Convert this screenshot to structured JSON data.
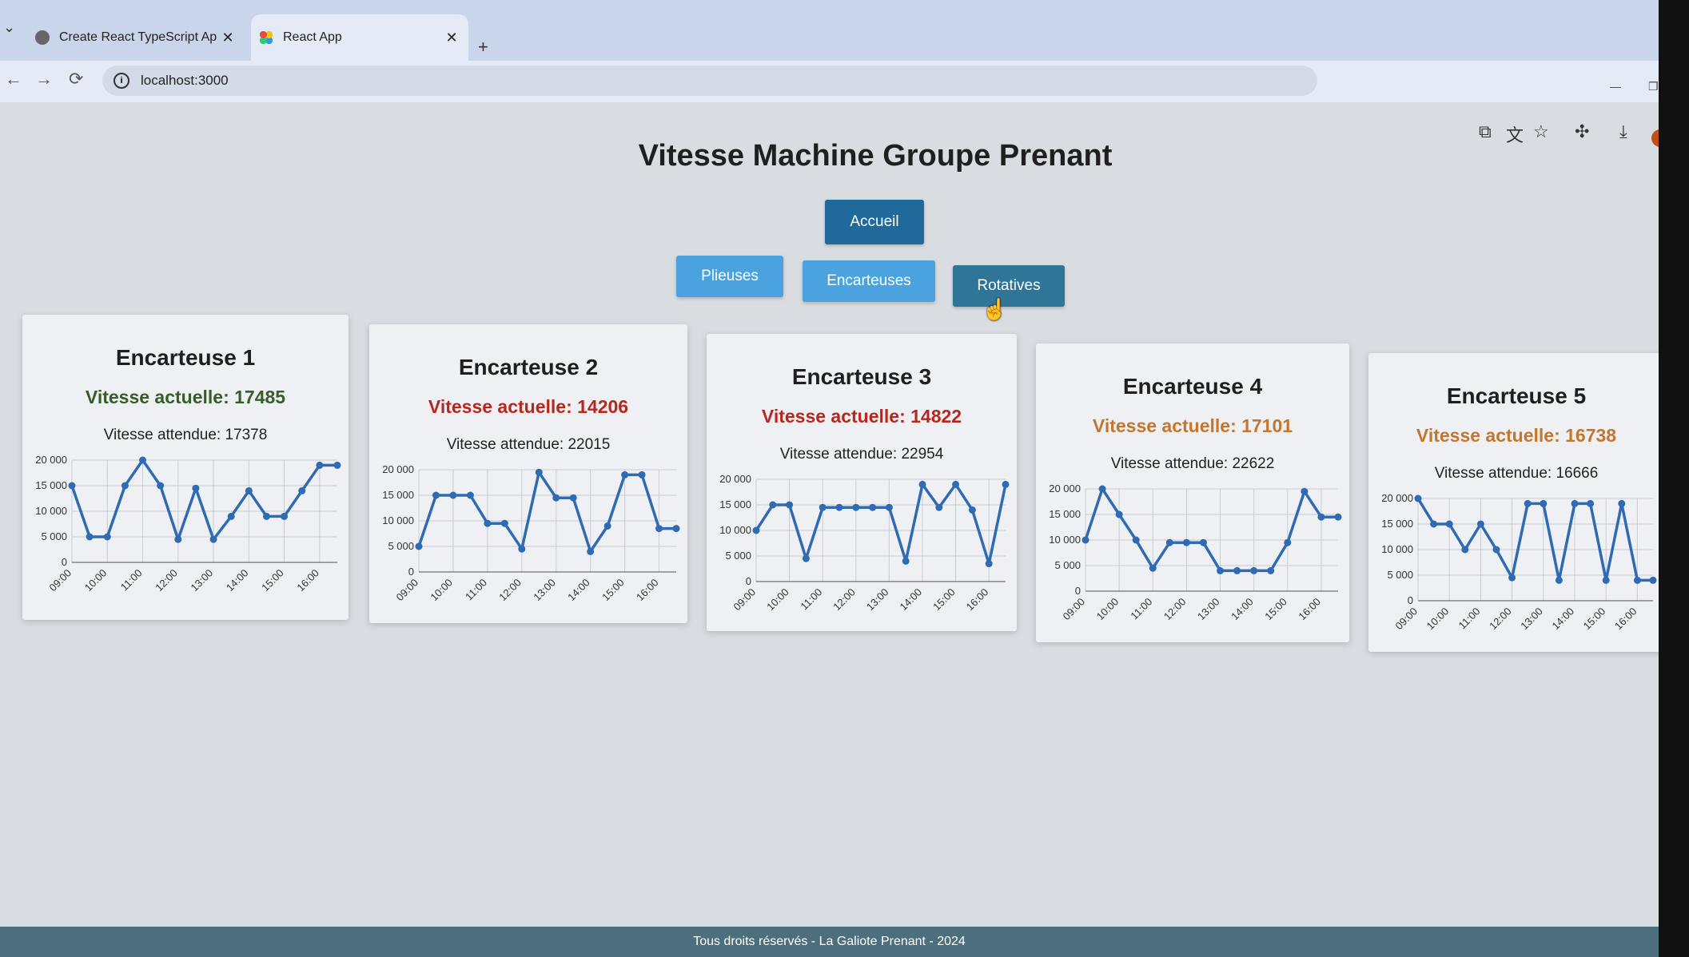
{
  "browser": {
    "tabs": [
      {
        "title": "Create React TypeScript App",
        "close": "✕"
      },
      {
        "title": "React App",
        "close": "✕"
      }
    ],
    "new_tab": "+",
    "url": "localhost:3000",
    "icons": [
      "back-icon",
      "forward-icon",
      "reload-icon",
      "info-icon",
      "cast-icon",
      "translate-icon",
      "star-icon",
      "extensions-icon",
      "download-icon",
      "profile-avatar"
    ],
    "profile_initial": "!"
  },
  "page": {
    "title": "Vitesse Machine Groupe Prenant",
    "home_button": "Accueil",
    "nav": [
      "Plieuses",
      "Encarteuses",
      "Rotatives"
    ],
    "footer": "Tous droits réservés - La Galiote Prenant - 2024",
    "colors": {
      "good": "#355e2a",
      "bad": "#b8271d",
      "warn": "#c3762e",
      "line": "#2f6bb3"
    }
  },
  "cards": [
    {
      "title": "Encarteuse 1",
      "current": "Vitesse actuelle: 17485",
      "expected": "Vitesse attendue: 17378",
      "status": "good"
    },
    {
      "title": "Encarteuse 2",
      "current": "Vitesse actuelle: 14206",
      "expected": "Vitesse attendue: 22015",
      "status": "bad"
    },
    {
      "title": "Encarteuse 3",
      "current": "Vitesse actuelle: 14822",
      "expected": "Vitesse attendue: 22954",
      "status": "bad"
    },
    {
      "title": "Encarteuse 4",
      "current": "Vitesse actuelle: 17101",
      "expected": "Vitesse attendue: 22622",
      "status": "warn"
    },
    {
      "title": "Encarteuse 5",
      "current": "Vitesse actuelle: 16738",
      "expected": "Vitesse attendue: 16666",
      "status": "warn"
    }
  ],
  "chart_data": [
    {
      "type": "line",
      "x": [
        "09:00",
        "09:30",
        "10:00",
        "10:30",
        "11:00",
        "11:30",
        "12:00",
        "12:30",
        "13:00",
        "13:30",
        "14:00",
        "14:30",
        "15:00",
        "15:30",
        "16:00",
        "16:30"
      ],
      "x_ticks": [
        "09:00",
        "10:00",
        "11:00",
        "12:00",
        "13:00",
        "14:00",
        "15:00",
        "16:00"
      ],
      "y_ticks": [
        "0",
        "5 000",
        "10 000",
        "15 000",
        "20 000"
      ],
      "ylim": [
        0,
        20000
      ],
      "grid": true,
      "values": [
        15000,
        5000,
        5000,
        15000,
        20000,
        15000,
        4500,
        14500,
        4500,
        9000,
        14000,
        9000,
        9000,
        14000,
        19000,
        19000
      ]
    },
    {
      "type": "line",
      "x": [
        "09:00",
        "09:30",
        "10:00",
        "10:30",
        "11:00",
        "11:30",
        "12:00",
        "12:30",
        "13:00",
        "13:30",
        "14:00",
        "14:30",
        "15:00",
        "15:30",
        "16:00",
        "16:30"
      ],
      "x_ticks": [
        "09:00",
        "10:00",
        "11:00",
        "12:00",
        "13:00",
        "14:00",
        "15:00",
        "16:00"
      ],
      "y_ticks": [
        "0",
        "5 000",
        "10 000",
        "15 000",
        "20 000"
      ],
      "ylim": [
        0,
        20000
      ],
      "grid": true,
      "values": [
        5000,
        15000,
        15000,
        15000,
        9500,
        9500,
        4500,
        19500,
        14500,
        14500,
        4000,
        9000,
        19000,
        19000,
        8500,
        8500
      ]
    },
    {
      "type": "line",
      "x": [
        "09:00",
        "09:30",
        "10:00",
        "10:30",
        "11:00",
        "11:30",
        "12:00",
        "12:30",
        "13:00",
        "13:30",
        "14:00",
        "14:30",
        "15:00",
        "15:30",
        "16:00",
        "16:30"
      ],
      "x_ticks": [
        "09:00",
        "10:00",
        "11:00",
        "12:00",
        "13:00",
        "14:00",
        "15:00",
        "16:00"
      ],
      "y_ticks": [
        "0",
        "5 000",
        "10 000",
        "15 000",
        "20 000"
      ],
      "ylim": [
        0,
        20000
      ],
      "grid": true,
      "values": [
        10000,
        15000,
        15000,
        4500,
        14500,
        14500,
        14500,
        14500,
        14500,
        4000,
        19000,
        14500,
        19000,
        14000,
        3500,
        19000
      ]
    },
    {
      "type": "line",
      "x": [
        "09:00",
        "09:30",
        "10:00",
        "10:30",
        "11:00",
        "11:30",
        "12:00",
        "12:30",
        "13:00",
        "13:30",
        "14:00",
        "14:30",
        "15:00",
        "15:30",
        "16:00",
        "16:30"
      ],
      "x_ticks": [
        "09:00",
        "10:00",
        "11:00",
        "12:00",
        "13:00",
        "14:00",
        "15:00",
        "16:00"
      ],
      "y_ticks": [
        "0",
        "5 000",
        "10 000",
        "15 000",
        "20 000"
      ],
      "ylim": [
        0,
        20000
      ],
      "grid": true,
      "values": [
        10000,
        20000,
        15000,
        10000,
        4500,
        9500,
        9500,
        9500,
        4000,
        4000,
        4000,
        4000,
        9500,
        19500,
        14500,
        14500
      ]
    },
    {
      "type": "line",
      "x": [
        "09:00",
        "09:30",
        "10:00",
        "10:30",
        "11:00",
        "11:30",
        "12:00",
        "12:30",
        "13:00",
        "13:30",
        "14:00",
        "14:30",
        "15:00",
        "15:30",
        "16:00",
        "16:30"
      ],
      "x_ticks": [
        "09:00",
        "10:00",
        "11:00",
        "12:00",
        "13:00",
        "14:00",
        "15:00",
        "16:00"
      ],
      "y_ticks": [
        "0",
        "5 000",
        "10 000",
        "15 000",
        "20 000"
      ],
      "ylim": [
        0,
        20000
      ],
      "grid": true,
      "values": [
        20000,
        15000,
        15000,
        10000,
        15000,
        10000,
        4500,
        19000,
        19000,
        4000,
        19000,
        19000,
        4000,
        19000,
        4000,
        4000
      ]
    }
  ]
}
